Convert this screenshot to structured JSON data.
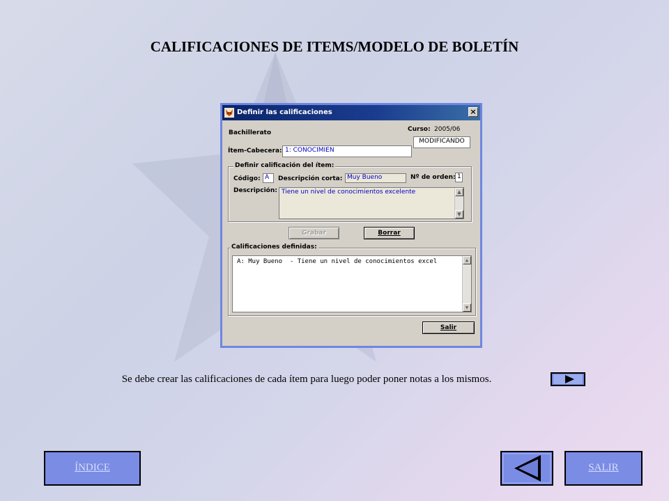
{
  "page": {
    "title": "CALIFICACIONES DE ITEMS/MODELO DE BOLETÍN",
    "caption": "Se debe crear las calificaciones de cada ítem para luego poder poner notas a los mismos.",
    "nav": {
      "index_label": "ÍNDICE",
      "exit_label": "SALIR"
    }
  },
  "window": {
    "title": "Definir las calificaciones",
    "close_glyph": "×",
    "level": "Bachillerato",
    "course_label": "Curso:",
    "course_value": "2005/06",
    "mode": "MODIFICANDO",
    "item_label": "Ítem-Cabecera:",
    "item_value": "1: CONOCIMIEN",
    "group_define_title": "Definir calificación del ítem:",
    "code_label": "Código:",
    "code_value": "A",
    "short_desc_label": "Descripción corta:",
    "short_desc_value": "Muy Bueno",
    "order_label": "Nº de orden:",
    "order_value": "1",
    "desc_label": "Descripción:",
    "desc_value": "Tiene un nivel de conocimientos excelente",
    "save_label": "Grabar",
    "delete_label": "Borrar",
    "group_list_title": "Calificaciones definidas:",
    "list_items": [
      "A: Muy Bueno  - Tiene un nivel de conocimientos excel"
    ],
    "exit_button_label": "Salir"
  },
  "colors": {
    "nav_button": "#7a8ce4",
    "window_border": "#6f86e0",
    "titlebar": "#0a246a"
  },
  "icons": {
    "app": "fox-icon",
    "scroll_up": "arrow-up-icon",
    "scroll_down": "arrow-down-icon",
    "next": "play-right-icon",
    "prev": "triangle-left-icon"
  }
}
